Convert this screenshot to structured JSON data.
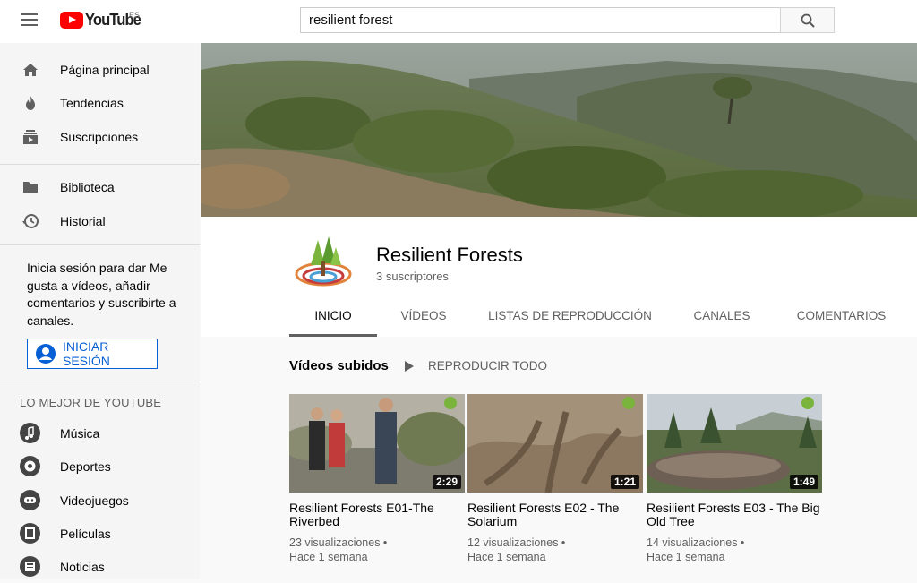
{
  "search": {
    "query": "resilient forest"
  },
  "logo": {
    "text": "YouTube",
    "country": "ES"
  },
  "sidebar": {
    "main": [
      {
        "label": "Página principal",
        "icon": "home-icon"
      },
      {
        "label": "Tendencias",
        "icon": "trending-icon"
      },
      {
        "label": "Suscripciones",
        "icon": "subscriptions-icon"
      }
    ],
    "library": [
      {
        "label": "Biblioteca",
        "icon": "folder-icon"
      },
      {
        "label": "Historial",
        "icon": "history-icon"
      }
    ],
    "signin_prompt": "Inicia sesión para dar Me gusta a vídeos, añadir comentarios y suscribirte a canales.",
    "signin_button": "INICIAR SESIÓN",
    "best_of_title": "LO MEJOR DE YOUTUBE",
    "best_of": [
      {
        "label": "Música",
        "icon": "music-icon"
      },
      {
        "label": "Deportes",
        "icon": "sports-icon"
      },
      {
        "label": "Videojuegos",
        "icon": "gaming-icon"
      },
      {
        "label": "Películas",
        "icon": "movies-icon"
      },
      {
        "label": "Noticias",
        "icon": "news-icon"
      }
    ]
  },
  "channel": {
    "name": "Resilient Forests",
    "subscribers": "3 suscriptores",
    "tabs": [
      "INICIO",
      "VÍDEOS",
      "LISTAS DE REPRODUCCIÓN",
      "CANALES",
      "COMENTARIOS"
    ],
    "active_tab": "INICIO"
  },
  "uploads": {
    "title": "Vídeos subidos",
    "play_all": "REPRODUCIR TODO",
    "videos": [
      {
        "title": "Resilient Forests E01-The Riverbed",
        "views": "23 visualizaciones",
        "age": "Hace 1 semana",
        "duration": "2:29"
      },
      {
        "title": "Resilient Forests E02 - The Solarium",
        "views": "12 visualizaciones",
        "age": "Hace 1 semana",
        "duration": "1:21"
      },
      {
        "title": "Resilient Forests E03 - The Big Old Tree",
        "views": "14 visualizaciones",
        "age": "Hace 1 semana",
        "duration": "1:49"
      }
    ]
  },
  "colors": {
    "accent": "#065fd4",
    "youtube_red": "#ff0000"
  }
}
